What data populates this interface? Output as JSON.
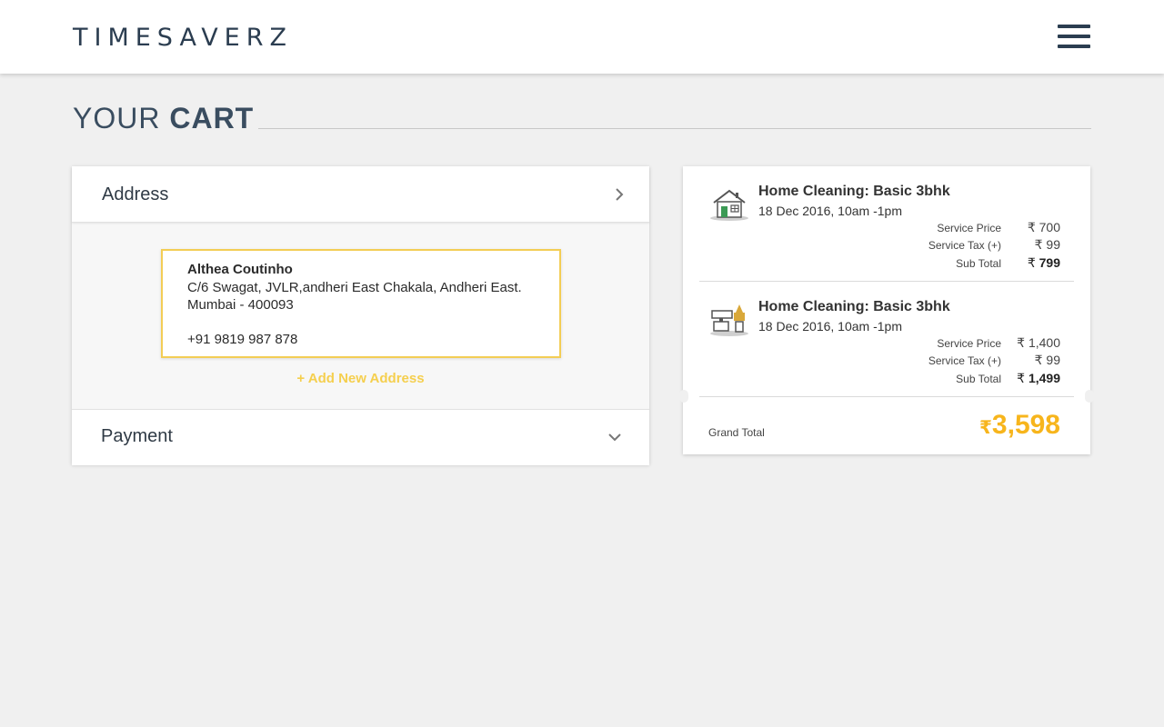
{
  "header": {
    "logo_text": "TIMESAVERZ",
    "menu_icon": "hamburger-menu-icon"
  },
  "page": {
    "title_light": "YOUR",
    "title_bold": "CART"
  },
  "checkout": {
    "address_section_title": "Address",
    "payment_section_title": "Payment",
    "address": {
      "name": "Althea Coutinho",
      "line": "C/6 Swagat, JVLR,andheri East Chakala, Andheri East. Mumbai - 400093",
      "phone": "+91 9819 987 878"
    },
    "add_new_address_label": "+ Add New Address"
  },
  "cart": {
    "items": [
      {
        "title": "Home Cleaning: Basic 3bhk",
        "date": "18 Dec 2016, 10am -1pm",
        "icon": "house-icon",
        "service_price_label": "Service Price",
        "service_price": "₹ 700",
        "service_tax_label": "Service Tax (+)",
        "service_tax": "₹ 99",
        "sub_total_label": "Sub Total",
        "sub_total_currency": "₹",
        "sub_total": "799"
      },
      {
        "title": "Home Cleaning: Basic 3bhk",
        "date": "18 Dec 2016, 10am -1pm",
        "icon": "cleaning-tools-icon",
        "service_price_label": "Service Price",
        "service_price": "₹ 1,400",
        "service_tax_label": "Service Tax (+)",
        "service_tax": "₹ 99",
        "sub_total_label": "Sub Total",
        "sub_total_currency": "₹",
        "sub_total": "1,499"
      }
    ],
    "grand_total_label": "Grand Total",
    "grand_total_currency": "₹",
    "grand_total": "3,598"
  },
  "colors": {
    "accent_yellow": "#f5cf4e",
    "grand_total": "#f7b51c",
    "brand_navy": "#2b3d50"
  }
}
